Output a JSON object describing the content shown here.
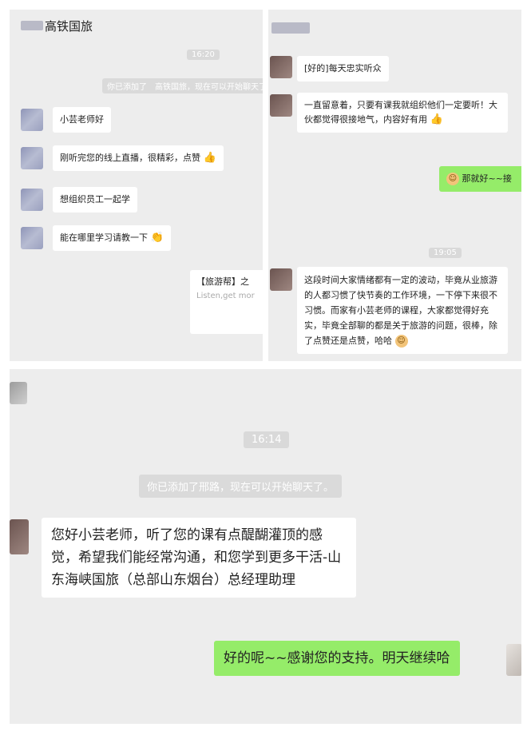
{
  "panel1": {
    "title": "高铁国旅",
    "time": "16:20",
    "system_notice": "你已添加了",
    "system_notice_tail": "高铁国旅，现在可以开始聊天了。",
    "messages": [
      {
        "text": "小芸老师好"
      },
      {
        "text": "刚听完您的线上直播，很精彩，点赞"
      },
      {
        "text": "想组织员工一起学"
      },
      {
        "text": "能在哪里学习请教一下"
      }
    ],
    "card": {
      "title": "【旅游帮】之",
      "subtitle": "Listen,get mor"
    }
  },
  "panel2": {
    "messages": [
      {
        "text": "[好的]每天忠实听众"
      },
      {
        "text": "一直留意着，只要有课我就组织他们一定要听！大伙都觉得很接地气，内容好有用"
      },
      {
        "text": "那就好~~接"
      }
    ],
    "time": "19:05",
    "long_message": "这段时间大家情绪都有一定的波动，毕竟从业旅游的人都习惯了快节奏的工作环境，一下停下来很不习惯。而家有小芸老师的课程，大家都觉得好充实，毕竟全部聊的都是关于旅游的问题，很棒，除了点赞还是点赞，哈哈"
  },
  "panel3": {
    "time": "16:14",
    "system_notice": "你已添加了邢路，现在可以开始聊天了。",
    "message_in": "您好小芸老师，听了您的课有点醍醐灌顶的感觉，希望我们能经常沟通，和您学到更多干活-山东海峡国旅（总部山东烟台）总经理助理",
    "message_out": "好的呢~~感谢您的支持。明天继续哈"
  }
}
